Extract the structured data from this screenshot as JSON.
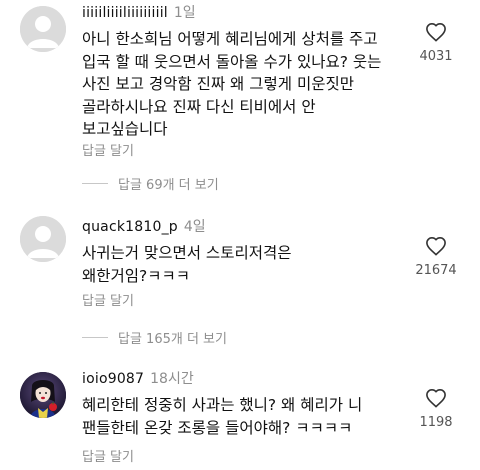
{
  "colors": {
    "text": "#111111",
    "secondary": "#8e8e8e",
    "divider": "#c7c7c7",
    "avatar_placeholder": "#dbdbdb"
  },
  "comments": [
    {
      "username": "iiiiiliiiiliiiiiiiiil",
      "time": "1일",
      "avatar": "default-avatar",
      "lines": [
        "아니 한소희님 어떻게 혜리님에게 상처를 주고",
        "입국 할 때 웃으면서 돌아올 수가 있나요? 웃는",
        "사진 보고 경악함 진짜 왜 그렇게 미운짓만",
        "골라하시나요 진짜 다신 티비에서 안",
        "보고싶습니다"
      ],
      "reply_label": "답글 달기",
      "likes": "4031",
      "view_replies": "답글 69개 더 보기"
    },
    {
      "username": "quack1810_p",
      "time": "4일",
      "avatar": "default-avatar",
      "lines": [
        "사귀는거 맞으면서 스토리저격은",
        "왜한거임?ㅋㅋㅋ"
      ],
      "reply_label": "답글 달기",
      "likes": "21674",
      "view_replies": "답글 165개 더 보기"
    },
    {
      "username": "ioio9087",
      "time": "18시간",
      "avatar": "illustrated-avatar",
      "lines": [
        "혜리한테 정중히 사과는 했니? 왜 혜리가 니",
        "팬들한테 온갖 조롱을 들어야해? ㅋㅋㅋㅋ"
      ],
      "reply_label": "답글 달기",
      "likes": "1198"
    }
  ]
}
